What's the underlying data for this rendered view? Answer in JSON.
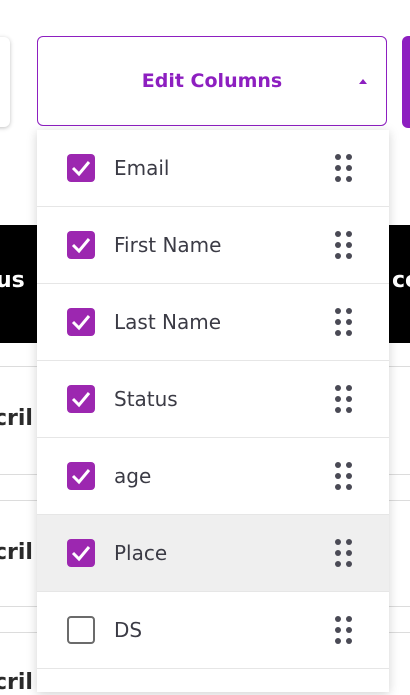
{
  "edit_columns": {
    "label": "Edit Columns",
    "caret_icon": "caret-up-icon",
    "accent_color": "#8d1fc0"
  },
  "columns": [
    {
      "label": "Email",
      "checked": true
    },
    {
      "label": "First Name",
      "checked": true
    },
    {
      "label": "Last Name",
      "checked": true
    },
    {
      "label": "Status",
      "checked": true
    },
    {
      "label": "age",
      "checked": true
    },
    {
      "label": "Place",
      "checked": true,
      "hovered": true
    },
    {
      "label": "DS",
      "checked": false
    }
  ],
  "background_table": {
    "header_left_text": "us",
    "header_right_text": "ce",
    "row_fragments": [
      "cril",
      "cril",
      "cril"
    ]
  },
  "colors": {
    "checkbox_checked": "#9c27b0",
    "header_bg": "#000000"
  }
}
